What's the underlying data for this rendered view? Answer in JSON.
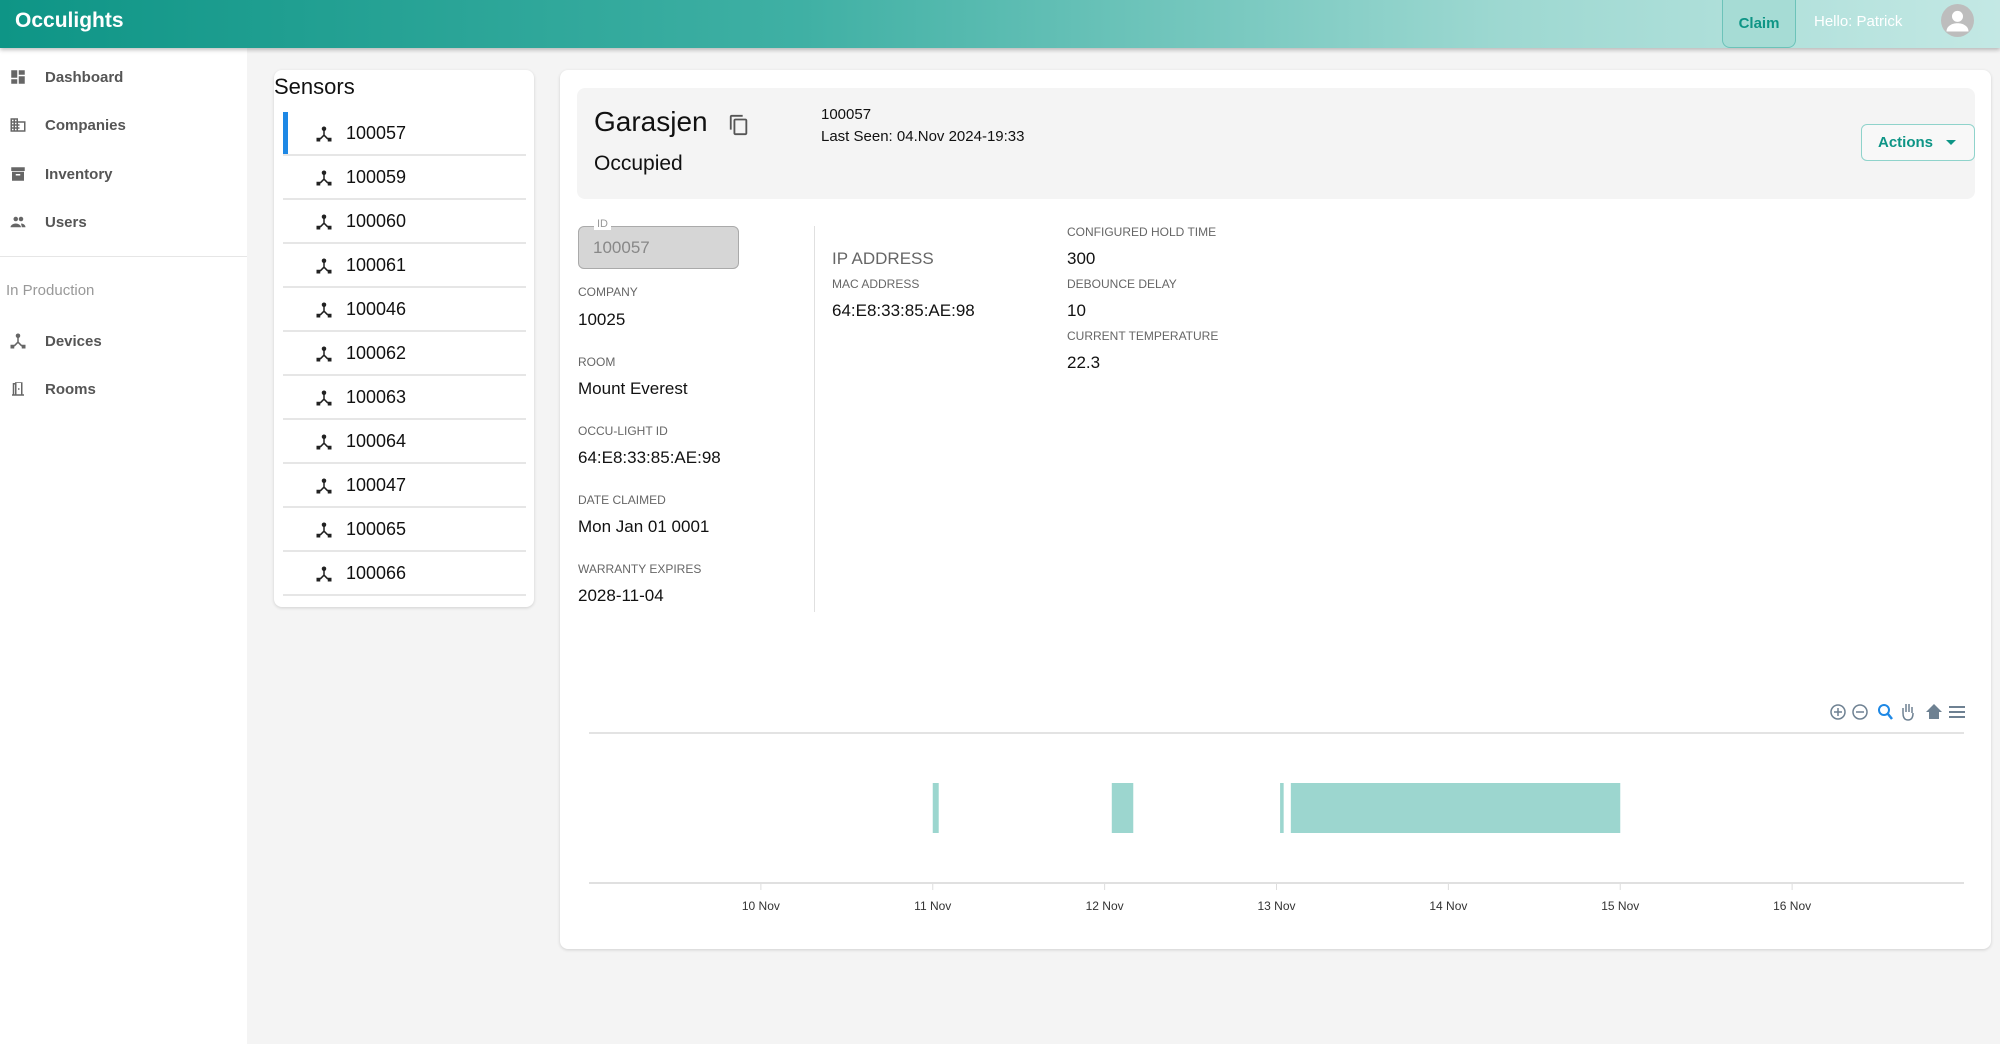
{
  "header": {
    "brand": "Occulights",
    "claim_label": "Claim",
    "greeting": "Hello: Patrick"
  },
  "sidebar": {
    "items": [
      {
        "label": "Dashboard",
        "icon": "dashboard-icon"
      },
      {
        "label": "Companies",
        "icon": "building-icon"
      },
      {
        "label": "Inventory",
        "icon": "archive-icon"
      },
      {
        "label": "Users",
        "icon": "users-icon"
      }
    ],
    "section_label": "In Production",
    "production_items": [
      {
        "label": "Devices",
        "icon": "device-hub-icon"
      },
      {
        "label": "Rooms",
        "icon": "door-icon"
      }
    ]
  },
  "sensors": {
    "title": "Sensors",
    "selected": "100057",
    "items": [
      "100057",
      "100059",
      "100060",
      "100061",
      "100046",
      "100062",
      "100063",
      "100064",
      "100047",
      "100065",
      "100066"
    ]
  },
  "device": {
    "name": "Garasjen",
    "status": "Occupied",
    "id": "100057",
    "last_seen": "Last Seen: 04.Nov 2024-19:33",
    "actions_label": "Actions",
    "fields": {
      "id_label": "ID",
      "id_value": "100057",
      "company_label": "COMPANY",
      "company": "10025",
      "room_label": "ROOM",
      "room": "Mount Everest",
      "occu_label": "OCCU-LIGHT ID",
      "occu": "64:E8:33:85:AE:98",
      "claimed_label": "DATE CLAIMED",
      "claimed": "Mon Jan 01 0001",
      "warranty_label": "WARRANTY EXPIRES",
      "warranty": "2028-11-04",
      "ip_label": "IP ADDRESS",
      "mac_label": "MAC ADDRESS",
      "mac": "64:E8:33:85:AE:98",
      "hold_label": "CONFIGURED HOLD TIME",
      "hold": "300",
      "debounce_label": "DEBOUNCE DELAY",
      "debounce": "10",
      "temp_label": "CURRENT TEMPERATURE",
      "temp": "22.3"
    }
  },
  "chart_toolbar": [
    "zoom-in-icon",
    "zoom-out-icon",
    "selection-zoom-icon",
    "pan-icon",
    "home-icon",
    "menu-icon"
  ],
  "chart_data": {
    "type": "timeline",
    "color": "#9cd6cf",
    "xlim": [
      "2024-11-09T00:00",
      "2024-11-17T00:00"
    ],
    "ticks": [
      "10 Nov",
      "11 Nov",
      "12 Nov",
      "13 Nov",
      "14 Nov",
      "15 Nov",
      "16 Nov"
    ],
    "ranges": [
      {
        "start": "2024-11-11T00:00",
        "end": "2024-11-11T00:50"
      },
      {
        "start": "2024-11-12T01:00",
        "end": "2024-11-12T04:00"
      },
      {
        "start": "2024-11-13T00:30",
        "end": "2024-11-13T01:00"
      },
      {
        "start": "2024-11-13T02:00",
        "end": "2024-11-15T00:00"
      }
    ]
  }
}
